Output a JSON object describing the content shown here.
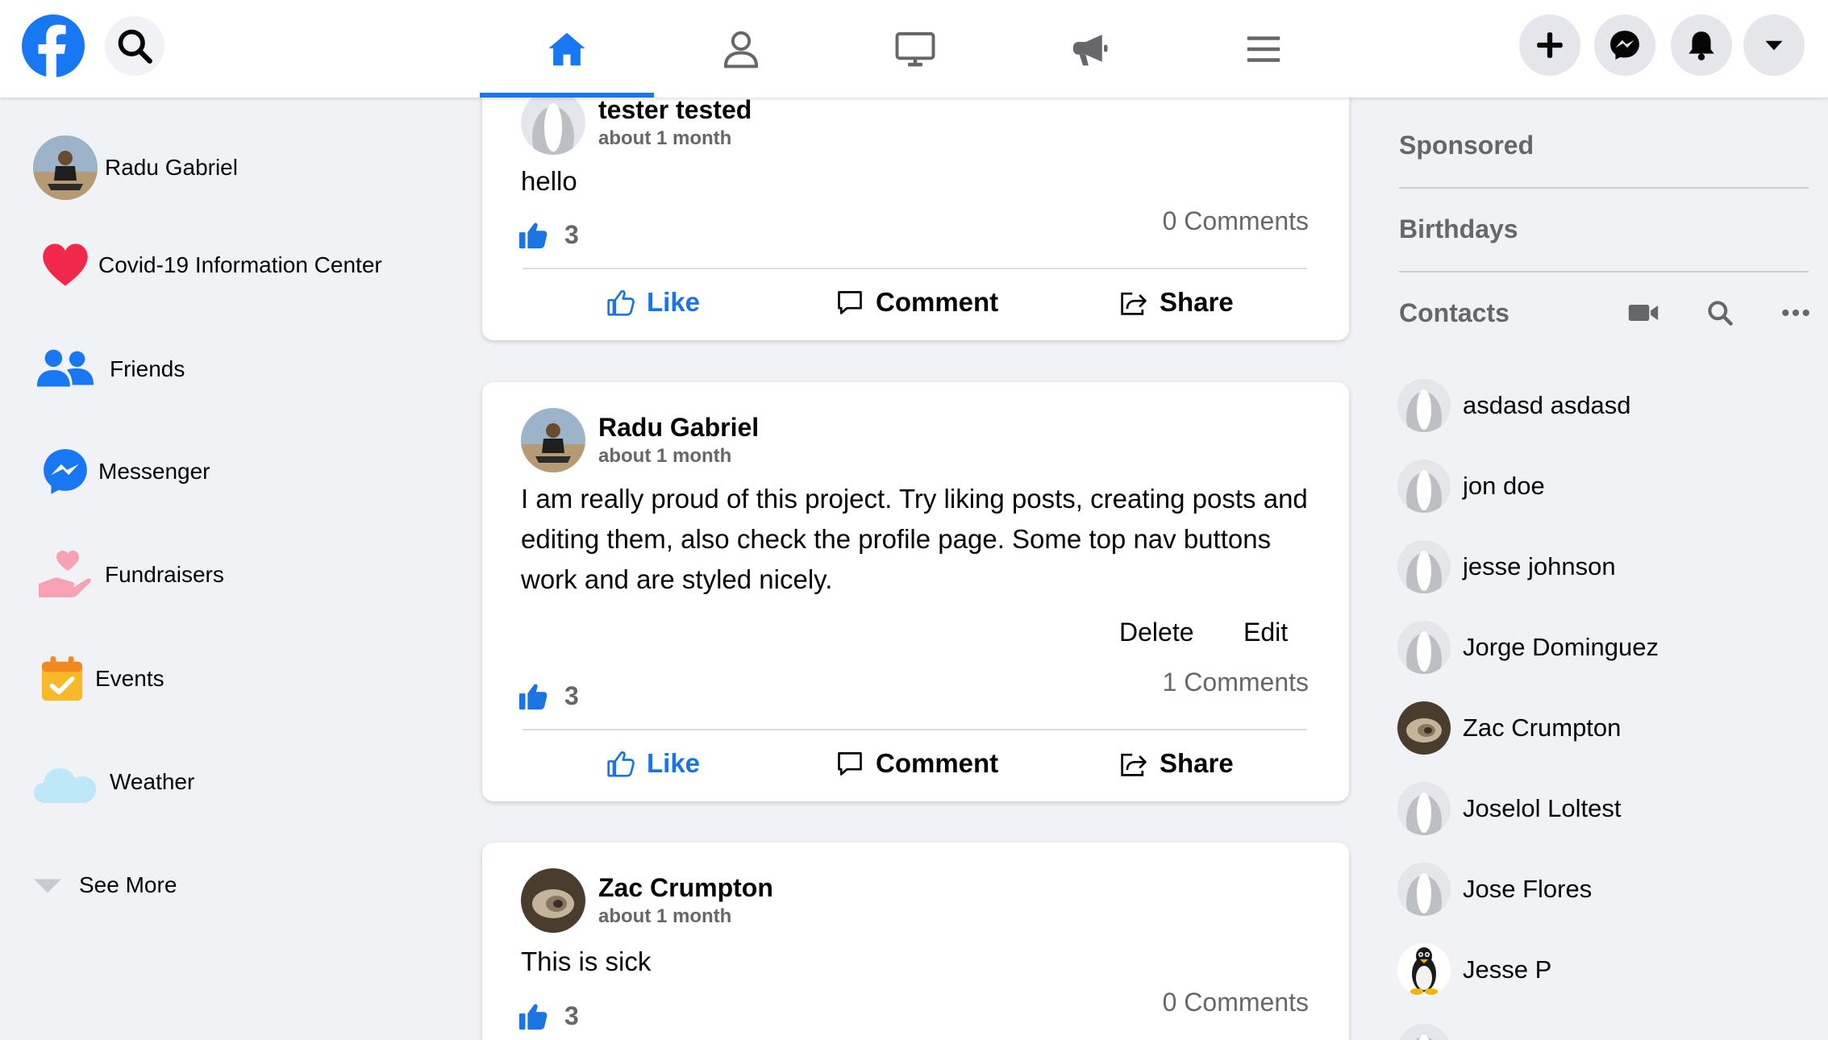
{
  "colors": {
    "accent": "#1877f2",
    "like_blue": "#1b74e4",
    "secondary_text": "#65676b",
    "page_bg": "#f0f2f5"
  },
  "topbar": {
    "logo_icon": "facebook-logo",
    "search_icon": "search-icon",
    "tabs": [
      {
        "name": "home",
        "icon": "home-icon",
        "active": true
      },
      {
        "name": "profile",
        "icon": "user-icon",
        "active": false
      },
      {
        "name": "watch",
        "icon": "monitor-icon",
        "active": false
      },
      {
        "name": "ads",
        "icon": "megaphone-icon",
        "active": false
      },
      {
        "name": "menu",
        "icon": "hamburger-icon",
        "active": false
      }
    ],
    "actions": [
      "plus-icon",
      "messenger-icon",
      "bell-icon",
      "caret-down-icon"
    ]
  },
  "sidebar": {
    "items": [
      {
        "label": "Radu Gabriel",
        "icon": "avatar"
      },
      {
        "label": "Covid-19 Information Center",
        "icon": "heart-icon"
      },
      {
        "label": "Friends",
        "icon": "friends-icon"
      },
      {
        "label": "Messenger",
        "icon": "messenger-icon"
      },
      {
        "label": "Fundraisers",
        "icon": "fundraiser-icon"
      },
      {
        "label": "Events",
        "icon": "calendar-icon"
      },
      {
        "label": "Weather",
        "icon": "cloud-icon"
      },
      {
        "label": "See More",
        "icon": "caret-down-icon"
      }
    ]
  },
  "posts": [
    {
      "author": "tester tested",
      "time": "about 1 month",
      "body": "hello",
      "likes": "3",
      "comments": "0 Comments",
      "actions": {
        "like": "Like",
        "comment": "Comment",
        "share": "Share"
      }
    },
    {
      "author": "Radu Gabriel",
      "time": "about 1 month",
      "body": "I am really proud of this project. Try liking posts, creating posts and editing them, also check the profile page. Some top nav buttons work and are styled nicely.",
      "likes": "3",
      "comments": "1 Comments",
      "delete": "Delete",
      "edit": "Edit",
      "actions": {
        "like": "Like",
        "comment": "Comment",
        "share": "Share"
      }
    },
    {
      "author": "Zac Crumpton",
      "time": "about 1 month",
      "body": "This is sick",
      "likes": "3",
      "comments": "0 Comments"
    }
  ],
  "right": {
    "sponsored": "Sponsored",
    "birthdays": "Birthdays",
    "contacts_heading": "Contacts",
    "contact_tools": [
      "video-icon",
      "search-icon",
      "more-icon"
    ],
    "contacts": [
      {
        "name": "asdasd asdasd",
        "avatar": "default"
      },
      {
        "name": "jon doe",
        "avatar": "default"
      },
      {
        "name": "jesse johnson",
        "avatar": "default"
      },
      {
        "name": "Jorge Dominguez",
        "avatar": "default"
      },
      {
        "name": "Zac Crumpton",
        "avatar": "photo"
      },
      {
        "name": "Joselol Loltest",
        "avatar": "default"
      },
      {
        "name": "Jose Flores",
        "avatar": "default"
      },
      {
        "name": "Jesse P",
        "avatar": "penguin"
      }
    ]
  }
}
